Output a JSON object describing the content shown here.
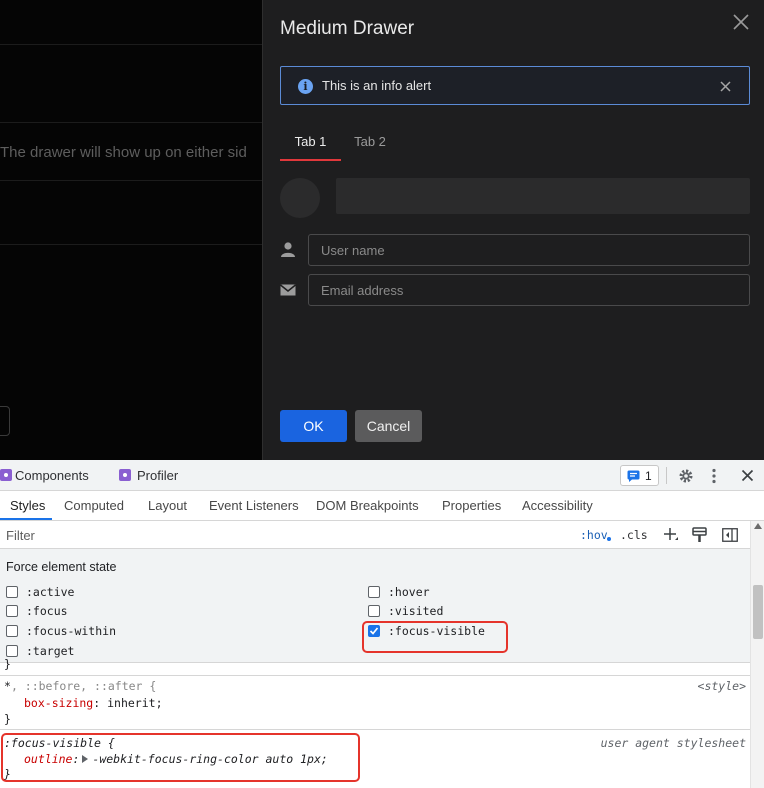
{
  "background": {
    "hint_text": "The drawer will show up on either sid"
  },
  "drawer": {
    "title": "Medium Drawer",
    "alert_text": "This is an info alert",
    "tabs": [
      {
        "label": "Tab 1"
      },
      {
        "label": "Tab 2"
      }
    ],
    "username_placeholder": "User name",
    "email_placeholder": "Email address",
    "ok_label": "OK",
    "cancel_label": "Cancel",
    "icons": [
      "close-icon",
      "info-icon",
      "user-icon",
      "mail-icon"
    ]
  },
  "devtools": {
    "panels": [
      "Components",
      "Profiler"
    ],
    "issues_count": "1",
    "subtabs": [
      "Styles",
      "Computed",
      "Layout",
      "Event Listeners",
      "DOM Breakpoints",
      "Properties",
      "Accessibility"
    ],
    "filter_placeholder": "Filter",
    "hov_label": ":hov",
    "cls_label": ".cls",
    "force_state_title": "Force element state",
    "pseudo_states": [
      {
        "label": ":active",
        "checked": false
      },
      {
        "label": ":hover",
        "checked": false
      },
      {
        "label": ":focus",
        "checked": false
      },
      {
        "label": ":visited",
        "checked": false
      },
      {
        "label": ":focus-within",
        "checked": false
      },
      {
        "label": ":focus-visible",
        "checked": true
      },
      {
        "label": ":target",
        "checked": false
      }
    ],
    "rules": [
      {
        "selector_main": "*",
        "selector_rest": ", ::before, ::after {",
        "origin": "<style>",
        "property": "box-sizing",
        "value": "inherit;"
      },
      {
        "selector_main": ":focus-visible {",
        "origin": "user agent stylesheet",
        "property": "outline",
        "value": "-webkit-focus-ring-color auto 1px;"
      }
    ],
    "closing_brace": "}",
    "accent_color": "#1a73e8",
    "highlight_color": "#e5342b"
  }
}
